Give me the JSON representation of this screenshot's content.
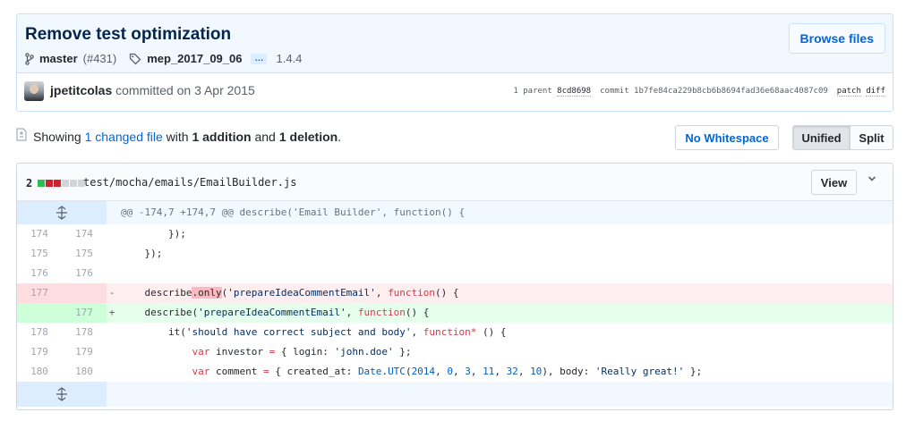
{
  "commit": {
    "title": "Remove test optimization",
    "branch": "master",
    "pr": "(#431)",
    "tag": "mep_2017_09_06",
    "ellipsis": "…",
    "version": "1.4.4",
    "browse_label": "Browse files",
    "author": "jpetitcolas",
    "committed_text": "committed on 3 Apr 2015",
    "parent_label": "1 parent",
    "parent_sha": "8cd8698",
    "commit_label": "commit",
    "commit_sha": "1b7fe84ca229b8cb6b8694fad36e68aac4087c09",
    "patch_label": "patch",
    "diff_label": "diff"
  },
  "toolbar": {
    "showing": "Showing",
    "changed": "1 changed file",
    "with": "with",
    "additions": "1 addition",
    "and": "and",
    "deletions": "1 deletion",
    "period": ".",
    "whitespace_label": "No Whitespace",
    "unified_label": "Unified",
    "split_label": "Split"
  },
  "file": {
    "changes": "2",
    "path": "test/mocha/emails/EmailBuilder.js",
    "view_label": "View",
    "stat_colors": [
      "#2cbe4e",
      "#cb2431",
      "#cb2431",
      "#d1d5da",
      "#d1d5da",
      "#d1d5da"
    ],
    "hunk_header": "@@ -174,7 +174,7 @@ describe('Email Builder', function() {",
    "lines": [
      {
        "old": "174",
        "new": "174"
      },
      {
        "old": "175",
        "new": "175"
      },
      {
        "old": "176",
        "new": "176"
      },
      {
        "old": "177",
        "new": "",
        "sign": "-"
      },
      {
        "old": "",
        "new": "177",
        "sign": "+"
      },
      {
        "old": "178",
        "new": "178"
      },
      {
        "old": "179",
        "new": "179"
      },
      {
        "old": "180",
        "new": "180"
      }
    ]
  }
}
